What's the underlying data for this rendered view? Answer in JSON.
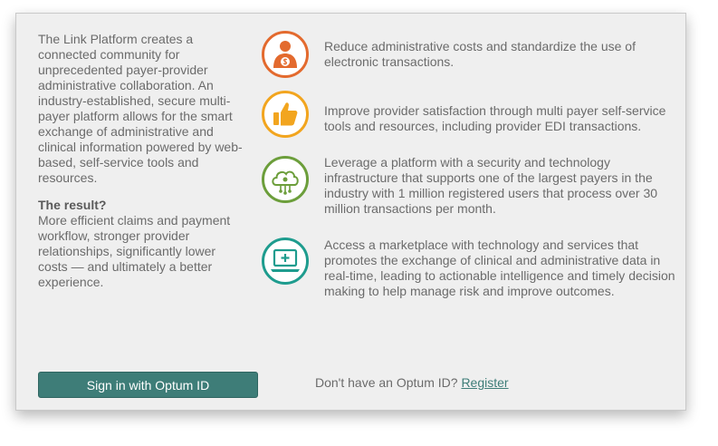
{
  "intro": {
    "paragraph": "The Link Platform creates a connected community for unprecedented payer-provider administrative collaboration. An industry-established, secure multi-payer platform allows for the smart exchange of administrative and clinical information powered by web-based, self-service tools and resources.",
    "result_heading": "The result?",
    "result_text": "More efficient claims and payment workflow, stronger provider relationships, significantly lower costs — and ultimately a better experience."
  },
  "benefits": [
    {
      "icon": "person-dollar-icon",
      "color": "#e36a2e",
      "text": "Reduce administrative costs and standardize the use of electronic transactions."
    },
    {
      "icon": "thumbs-up-icon",
      "color": "#f2a51f",
      "text": "Improve provider satisfaction through multi payer self-service tools and resources, including provider EDI transactions."
    },
    {
      "icon": "cloud-network-icon",
      "color": "#6c9e3b",
      "text": "Leverage a platform with a security and technology infrastructure that supports one of the largest payers in the industry with 1 million registered users that process over 30 million transactions per month."
    },
    {
      "icon": "laptop-medical-icon",
      "color": "#1e9c8e",
      "text": "Access a marketplace with technology and services that promotes the exchange of clinical and administrative data in real-time, leading to actionable intelligence and timely decision making to help manage risk and improve outcomes."
    }
  ],
  "actions": {
    "signin_label": "Sign in with Optum ID",
    "no_account_text": "Don't have an Optum ID?",
    "register_label": "Register",
    "button_color": "#3e7d78"
  }
}
